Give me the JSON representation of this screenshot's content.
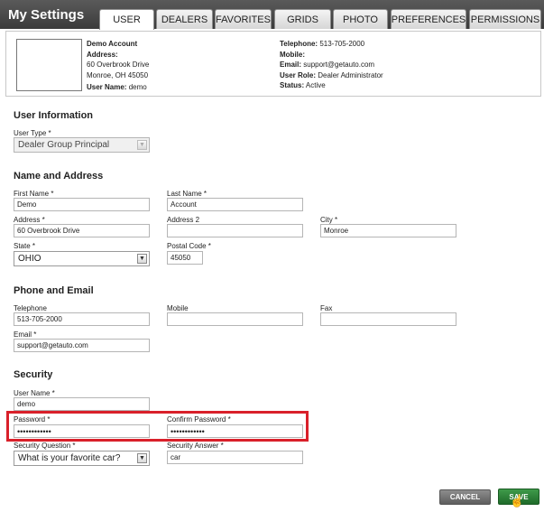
{
  "header": {
    "title": "My Settings"
  },
  "tabs": [
    {
      "label": "USER",
      "active": true
    },
    {
      "label": "DEALERS"
    },
    {
      "label": "FAVORITES"
    },
    {
      "label": "GRIDS"
    },
    {
      "label": "PHOTO"
    },
    {
      "label": "PREFERENCES"
    },
    {
      "label": "PERMISSIONS"
    }
  ],
  "summary": {
    "account_name": "Demo Account",
    "address_label": "Address:",
    "address_line1": "60 Overbrook Drive",
    "address_line2": "Monroe, OH 45050",
    "username_label": "User Name:",
    "username": "demo",
    "telephone_label": "Telephone:",
    "telephone": "513-705-2000",
    "mobile_label": "Mobile:",
    "mobile": "",
    "email_label": "Email:",
    "email": "support@getauto.com",
    "role_label": "User Role:",
    "role": "Dealer Administrator",
    "status_label": "Status:",
    "status": "Active"
  },
  "user_info": {
    "title": "User Information",
    "user_type_label": "User Type *",
    "user_type_value": "Dealer Group Principal"
  },
  "name_address": {
    "title": "Name and Address",
    "first_name_label": "First Name *",
    "first_name": "Demo",
    "last_name_label": "Last Name *",
    "last_name": "Account",
    "address_label": "Address *",
    "address": "60 Overbrook Drive",
    "address2_label": "Address 2",
    "address2": "",
    "city_label": "City *",
    "city": "Monroe",
    "state_label": "State *",
    "state": "OHIO",
    "postal_label": "Postal Code *",
    "postal": "45050"
  },
  "phone_email": {
    "title": "Phone and Email",
    "telephone_label": "Telephone",
    "telephone": "513-705-2000",
    "mobile_label": "Mobile",
    "mobile": "",
    "fax_label": "Fax",
    "fax": "",
    "email_label": "Email *",
    "email": "support@getauto.com"
  },
  "security": {
    "title": "Security",
    "username_label": "User Name *",
    "username": "demo",
    "password_label": "Password *",
    "password": "••••••••••••",
    "confirm_label": "Confirm Password *",
    "confirm": "••••••••••••",
    "question_label": "Security Question *",
    "question": "What is your favorite car?",
    "answer_label": "Security Answer *",
    "answer": "car"
  },
  "actions": {
    "cancel": "CANCEL",
    "save": "SAVE"
  },
  "colors": {
    "highlight": "#d9202a",
    "save": "#2e8a3b",
    "header": "#4a4a4a"
  }
}
